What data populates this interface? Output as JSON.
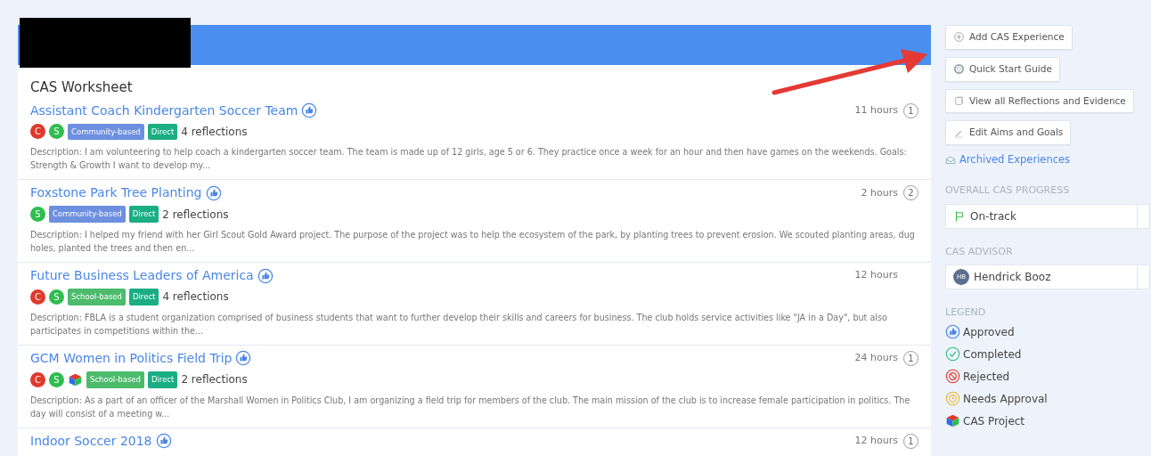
{
  "worksheet": {
    "title": "CAS Worksheet",
    "experiences": [
      {
        "title": "Assistant Coach Kindergarten Soccer Team",
        "approved": true,
        "hours": "11 hours",
        "comments": "1",
        "strands": [
          {
            "letter": "C",
            "color": "#e0392b"
          },
          {
            "letter": "S",
            "color": "#2ebd4e"
          }
        ],
        "project": false,
        "type": {
          "label": "Community-based",
          "kind": "community"
        },
        "mode": "Direct",
        "reflections": "4 reflections",
        "description": "Description: I am volunteering to help coach a kindergarten soccer team. The team is made up of 12 girls, age 5 or 6. They practice once a week for an hour and then have games on the weekends. Goals: Strength & Growth I want to develop my..."
      },
      {
        "title": "Foxstone Park Tree Planting",
        "approved": true,
        "hours": "2 hours",
        "comments": "2",
        "strands": [
          {
            "letter": "S",
            "color": "#2ebd4e"
          }
        ],
        "project": false,
        "type": {
          "label": "Community-based",
          "kind": "community"
        },
        "mode": "Direct",
        "reflections": "2 reflections",
        "description": "Description: I helped my friend with her Girl Scout Gold Award project. The purpose of the project was to help the ecosystem of the park, by planting trees to prevent erosion. We scouted planting areas, dug holes, planted the trees and then en..."
      },
      {
        "title": "Future Business Leaders of America",
        "approved": true,
        "hours": "12 hours",
        "strands": [
          {
            "letter": "C",
            "color": "#e0392b"
          },
          {
            "letter": "S",
            "color": "#2ebd4e"
          }
        ],
        "project": false,
        "type": {
          "label": "School-based",
          "kind": "school"
        },
        "mode": "Direct",
        "reflections": "4 reflections",
        "description": "Description: FBLA is a student organization comprised of business students that want to further develop their skills and careers for business. The club holds service activities like \"JA in a Day\", but also participates in competitions within the..."
      },
      {
        "title": "GCM Women in Politics Field Trip",
        "approved": true,
        "hours": "24 hours",
        "comments": "1",
        "strands": [
          {
            "letter": "C",
            "color": "#e0392b"
          },
          {
            "letter": "S",
            "color": "#2ebd4e"
          }
        ],
        "project": true,
        "type": {
          "label": "School-based",
          "kind": "school"
        },
        "mode": "Direct",
        "reflections": "2 reflections",
        "description": "Description: As a part of an officer of the Marshall Women in Politics Club, I am organizing a field trip for members of the club. The main mission of the club is to increase female participation in politics. The day will consist of a meeting w..."
      },
      {
        "title": "Indoor Soccer 2018",
        "approved": true,
        "hours": "12 hours",
        "comments": "1"
      }
    ]
  },
  "sidebar": {
    "buttons": [
      {
        "kind": "add",
        "label": "Add CAS Experience"
      },
      {
        "kind": "guide",
        "label": "Quick Start Guide"
      },
      {
        "kind": "reflections",
        "label": "View all Reflections and Evidence"
      },
      {
        "kind": "edit",
        "label": "Edit Aims and Goals"
      }
    ],
    "archived_link": "Archived Experiences",
    "progress": {
      "label": "OVERALL CAS PROGRESS",
      "value": "On-track"
    },
    "advisor": {
      "label": "CAS ADVISOR",
      "initials": "HB",
      "name": "Hendrick Booz"
    },
    "legend": {
      "label": "LEGEND",
      "items": [
        {
          "kind": "approved",
          "label": "Approved"
        },
        {
          "kind": "completed",
          "label": "Completed"
        },
        {
          "kind": "rejected",
          "label": "Rejected"
        },
        {
          "kind": "needs_approval",
          "label": "Needs Approval"
        },
        {
          "kind": "project",
          "label": "CAS Project"
        }
      ]
    }
  }
}
